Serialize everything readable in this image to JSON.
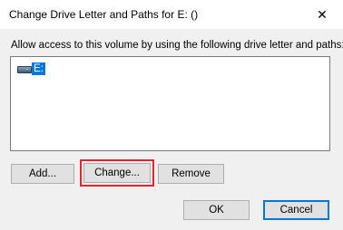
{
  "window": {
    "title": "Change Drive Letter and Paths for E: ()",
    "close_glyph": "✕"
  },
  "dialog": {
    "instruction": "Allow access to this volume by using the following drive letter and paths:",
    "list_items": [
      {
        "label": "E:",
        "icon": "drive-icon",
        "selected": true
      }
    ]
  },
  "buttons": {
    "add": "Add...",
    "change": "Change...",
    "remove": "Remove",
    "ok": "OK",
    "cancel": "Cancel"
  },
  "colors": {
    "selection": "#0078d7",
    "highlight_outline": "#e0262b"
  }
}
